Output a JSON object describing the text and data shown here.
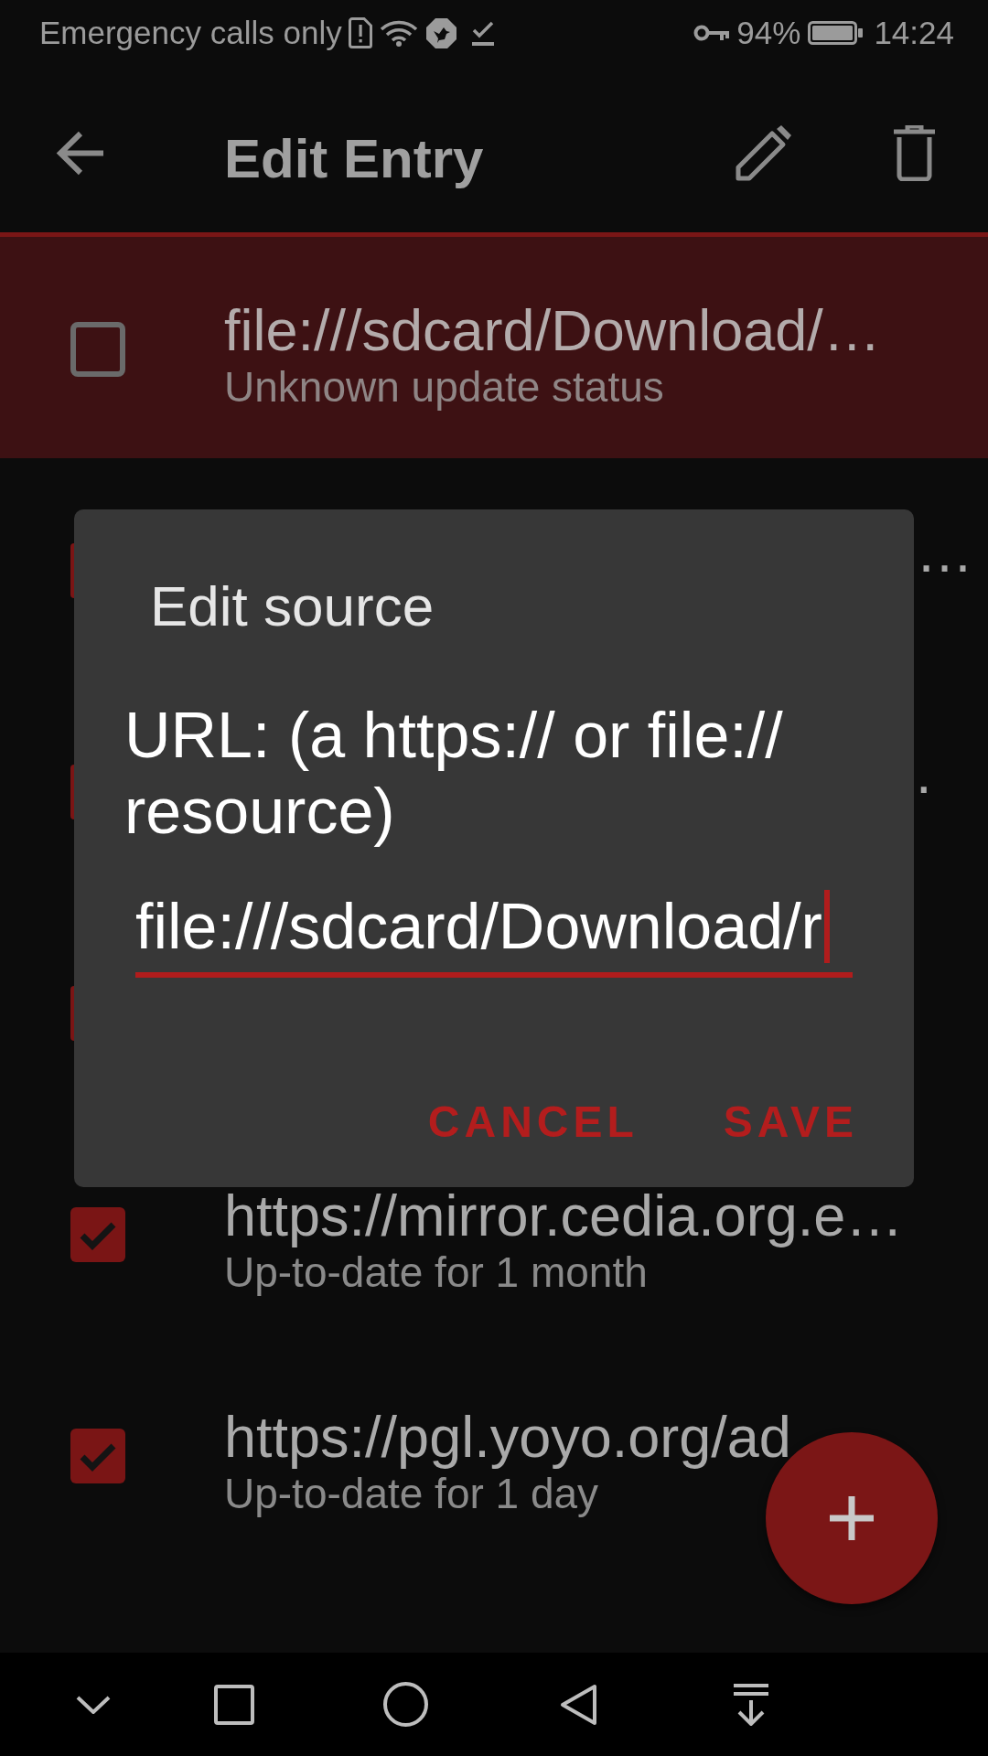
{
  "status_bar": {
    "carrier": "Emergency calls only",
    "battery": "94%",
    "time": "14:24"
  },
  "toolbar": {
    "title": "Edit Entry"
  },
  "entries": [
    {
      "title": "file:///sdcard/Download/…",
      "status": "Unknown update status",
      "checked": false,
      "selected": true
    },
    {
      "title": "…",
      "checked": true,
      "selected": false
    },
    {
      "title": ".",
      "checked": true,
      "selected": false
    },
    {
      "checked": true,
      "selected": false
    },
    {
      "title": "https://mirror.cedia.org.e…",
      "status": "Up-to-date for 1 month",
      "checked": true,
      "selected": false
    },
    {
      "title": "https://pgl.yoyo.org/ad",
      "status": "Up-to-date for 1 day",
      "checked": true,
      "selected": false
    }
  ],
  "dialog": {
    "title": "Edit source",
    "message": "URL: (a https:// or file:// resource)",
    "field": {
      "value": "file:///sdcard/Download/r"
    },
    "buttons": [
      "CANCEL",
      "SAVE"
    ]
  }
}
